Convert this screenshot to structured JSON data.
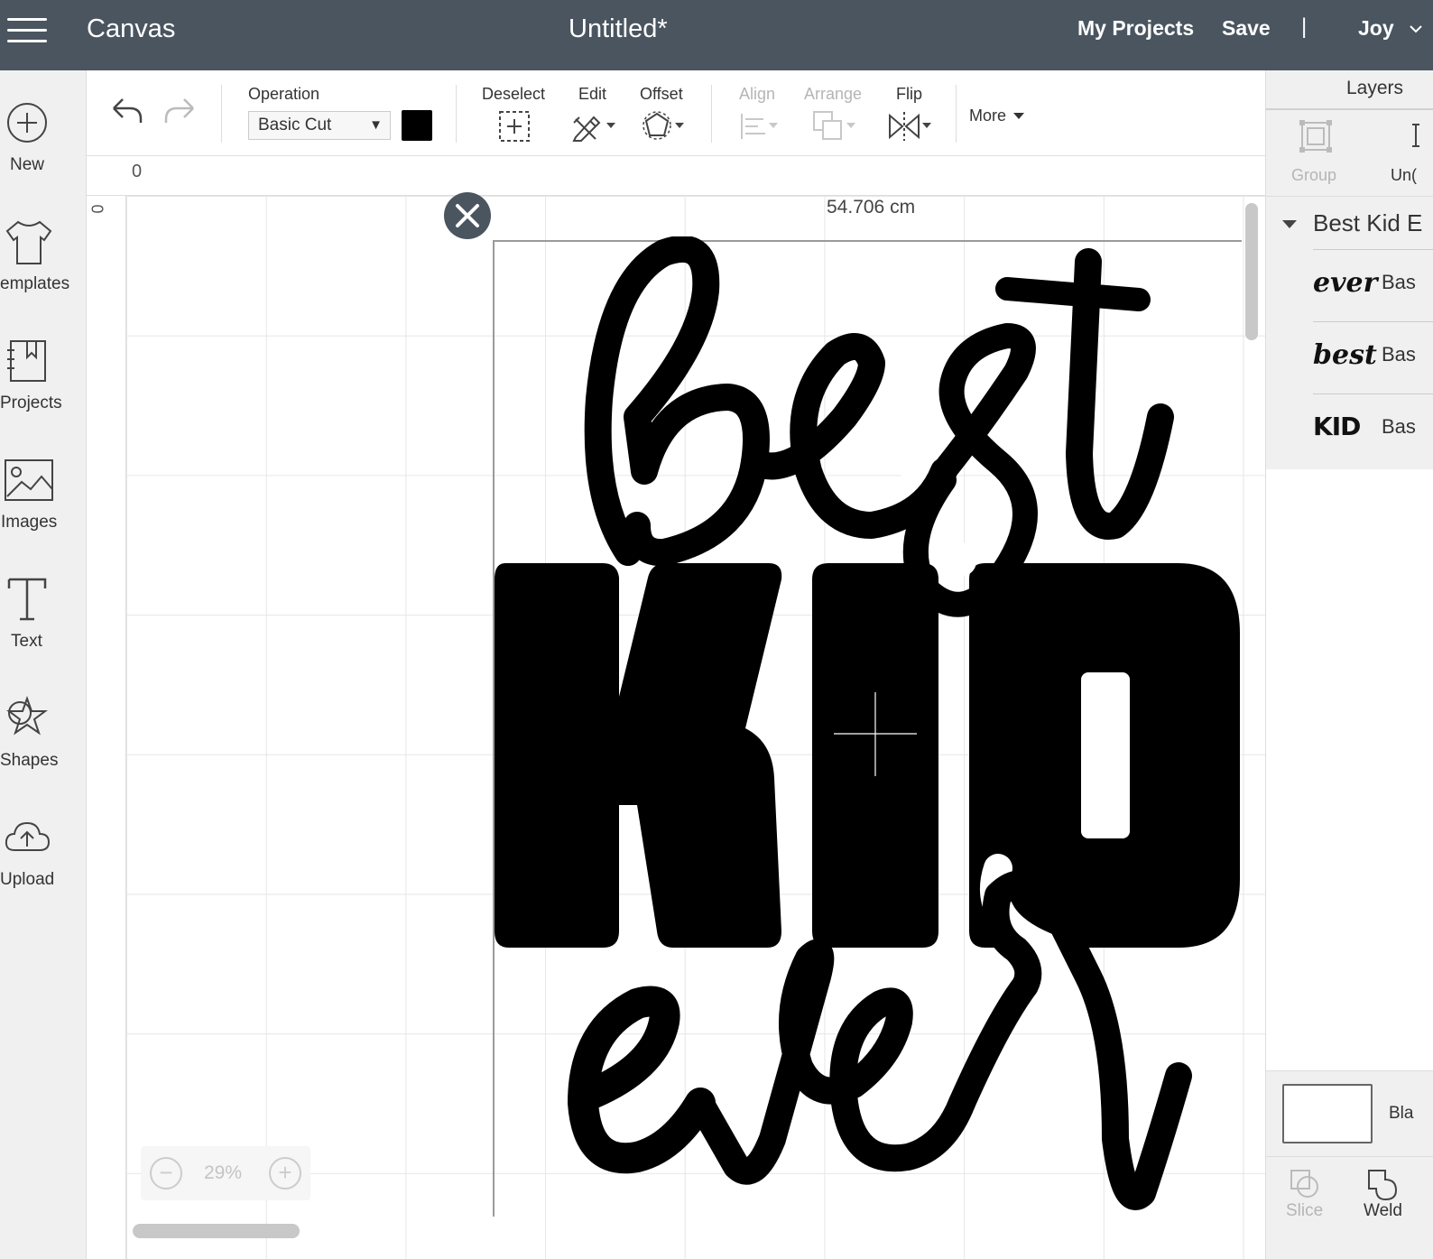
{
  "header": {
    "app_title": "Canvas",
    "document_title": "Untitled*",
    "my_projects": "My Projects",
    "save": "Save",
    "separator": "|",
    "user": "Joy"
  },
  "sidebar": {
    "items": [
      {
        "label": "New",
        "icon": "plus-circle-icon"
      },
      {
        "label": "emplates",
        "icon": "tshirt-icon"
      },
      {
        "label": "Projects",
        "icon": "projects-icon"
      },
      {
        "label": "Images",
        "icon": "image-icon"
      },
      {
        "label": "Text",
        "icon": "text-icon"
      },
      {
        "label": "Shapes",
        "icon": "shapes-icon"
      },
      {
        "label": "Upload",
        "icon": "cloud-upload-icon"
      }
    ]
  },
  "toolbar": {
    "operation_label": "Operation",
    "operation_value": "Basic Cut",
    "operation_color": "#000000",
    "deselect": "Deselect",
    "edit": "Edit",
    "offset": "Offset",
    "align": "Align",
    "arrange": "Arrange",
    "flip": "Flip",
    "more": "More"
  },
  "rulers": {
    "top_zero": "0",
    "left_zero": "0"
  },
  "canvas": {
    "dimension_label": "54.706 cm",
    "zoom_level": "29%",
    "zoom_out": "−",
    "zoom_in": "+"
  },
  "layers_panel": {
    "title": "Layers",
    "group": "Group",
    "ungroup": "Un(",
    "group_name": "Best Kid E",
    "layers": [
      {
        "thumb": "ever",
        "name": "Bas"
      },
      {
        "thumb": "best",
        "name": "Bas"
      },
      {
        "thumb": "KID",
        "name": "Bas"
      }
    ],
    "canvas_label": "Bla",
    "slice": "Slice",
    "weld": "Weld"
  },
  "colors": {
    "header_bg": "#4a5560",
    "artwork": "#000000",
    "sidebar_bg": "#f0f0f0"
  }
}
